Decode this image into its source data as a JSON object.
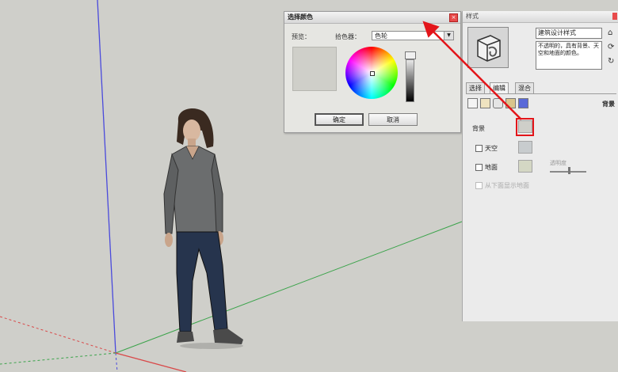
{
  "color_dialog": {
    "title": "选择颜色",
    "close_symbol": "×",
    "preview_label": "预览：",
    "picker_label": "拾色器：",
    "picker_value": "色轮",
    "dropdown_symbol": "▼",
    "ok_label": "确定",
    "cancel_label": "取消",
    "preview_color": "#cfcfc9"
  },
  "styles_panel": {
    "title": "样式",
    "style_name": "建筑设计样式",
    "style_description": "不透明的，具有背景、天空和地面的颜色。",
    "tabs": [
      {
        "label": "选择"
      },
      {
        "label": "编辑"
      },
      {
        "label": "混合"
      }
    ],
    "section_label": "背景",
    "background_label": "背景",
    "background_color": "#cfcfc9",
    "sky_label": "天空",
    "sky_color": "#c8ccce",
    "ground_label": "地面",
    "ground_color": "#d4d7c4",
    "transparency_label": "透明度",
    "ground_from_below_label": "从下面显示地面",
    "side_icons": [
      "home-icon",
      "update-icon",
      "refresh-icon"
    ],
    "side_icon_glyphs": [
      "⌂",
      "⟳",
      "↻"
    ]
  },
  "annotation": {
    "color": "#e3151a"
  },
  "colors": {
    "scene_bg": "#cfcfca",
    "axis_red": "#d94848",
    "axis_green": "#3aa34a",
    "axis_blue": "#4a4adc"
  }
}
